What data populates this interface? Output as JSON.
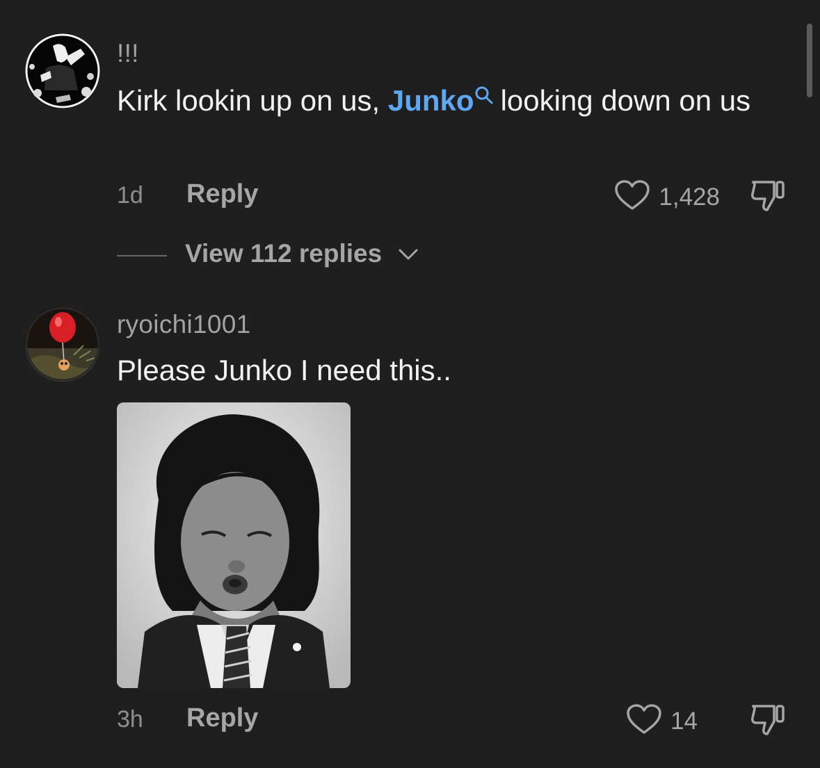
{
  "comments": [
    {
      "username": "!!!",
      "text_before": "Kirk lookin up on us, ",
      "mention": "Junko",
      "text_after": "looking down on us",
      "time": "1d",
      "reply_label": "Reply",
      "likes": "1,428",
      "view_replies_label": "View 112 replies"
    },
    {
      "username": "ryoichi1001",
      "text": "Please Junko I need this..",
      "time": "3h",
      "reply_label": "Reply",
      "likes": "14"
    }
  ],
  "icons": {
    "like": "heart-outline-icon",
    "dislike": "thumbs-down-icon",
    "search": "search-icon",
    "chevron": "chevron-down-icon"
  },
  "colors": {
    "background": "#1f1f1f",
    "mention": "#5ea8f2",
    "secondary_text": "#a6a6a6",
    "primary_text": "#f2f2f2"
  }
}
